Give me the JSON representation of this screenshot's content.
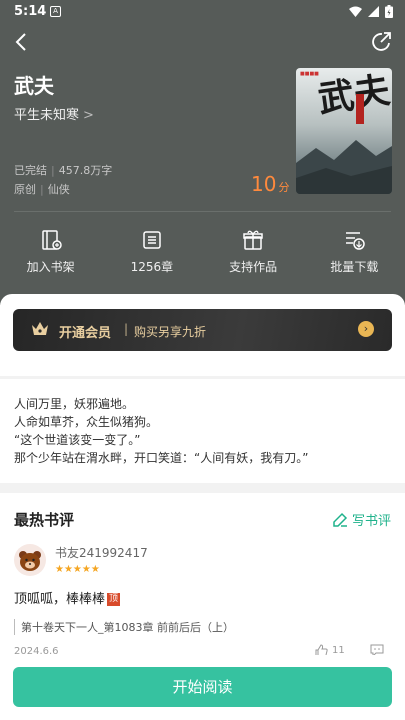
{
  "status_bar": {
    "time": "5:14"
  },
  "book": {
    "title": "武夫",
    "author": "平生未知寒",
    "status": "已完结",
    "word_count": "457.8万字",
    "type": "原创",
    "genre": "仙侠",
    "score": "10",
    "score_unit": "分",
    "cover_title": "武夫"
  },
  "actions": [
    {
      "label": "加入书架",
      "icon": "bookshelf-add-icon"
    },
    {
      "label": "1256章",
      "icon": "chapter-list-icon"
    },
    {
      "label": "支持作品",
      "icon": "gift-icon"
    },
    {
      "label": "批量下载",
      "icon": "download-icon"
    }
  ],
  "vip": {
    "title": "开通会员",
    "subtitle": "购买另享九折"
  },
  "intro": [
    "人间万里，妖邪遍地。",
    "人命如草芥，众生似猪狗。",
    "“这个世道该变一变了。”",
    "那个少年站在渭水畔，开口笑道：“人间有妖，我有刀。”"
  ],
  "comments": {
    "heading": "最热书评",
    "write_label": "写书评",
    "items": [
      {
        "user": "书友241992417",
        "rating": 5,
        "text": "顶呱呱，棒棒棒",
        "chapter": "第十卷天下一人_第1083章 前前后后（上）",
        "date": "2024.6.6",
        "likes": "11"
      }
    ]
  },
  "read_button": "开始阅读",
  "colors": {
    "hero_bg": "#565b58",
    "accent": "#36c2a0",
    "score": "#ff8a3d",
    "vip_gold": "#e9cfa0"
  }
}
